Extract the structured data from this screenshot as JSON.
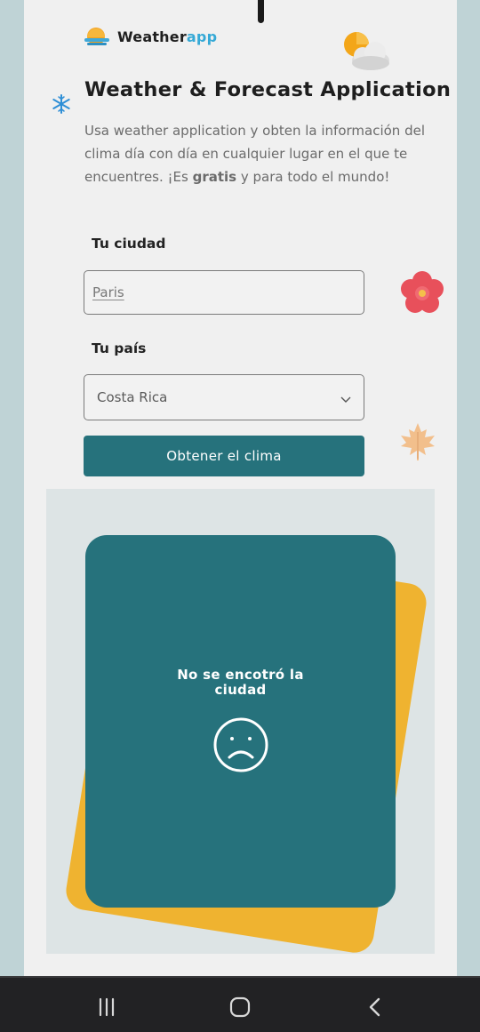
{
  "app": {
    "brand_main": "Weather",
    "brand_accent": "app"
  },
  "hero": {
    "title": "Weather & Forecast Application",
    "desc_before": "Usa weather application y obten la información del clima día con día en cualquier lugar en el que te encuentres. ¡Es ",
    "desc_bold": "gratis",
    "desc_after": " y para todo el mundo!"
  },
  "form": {
    "city_label": "Tu ciudad",
    "city_value": "Paris",
    "country_label": "Tu país",
    "country_value": "Costa Rica",
    "submit_label": "Obtener el clima"
  },
  "result": {
    "message": "No se encotró la ciudad"
  },
  "colors": {
    "accent": "#26727c",
    "brand_accent": "#35a9d6",
    "card_back": "#efb330",
    "page_bg": "#f0f0f0",
    "side_bg": "#bfd3d6"
  },
  "icons": {
    "logo": "sun-over-water-icon",
    "cloud": "sun-cloud-icon",
    "snow": "snowflake-icon",
    "flower": "flower-icon",
    "leaf": "maple-leaf-icon",
    "sad": "sad-face-icon"
  }
}
